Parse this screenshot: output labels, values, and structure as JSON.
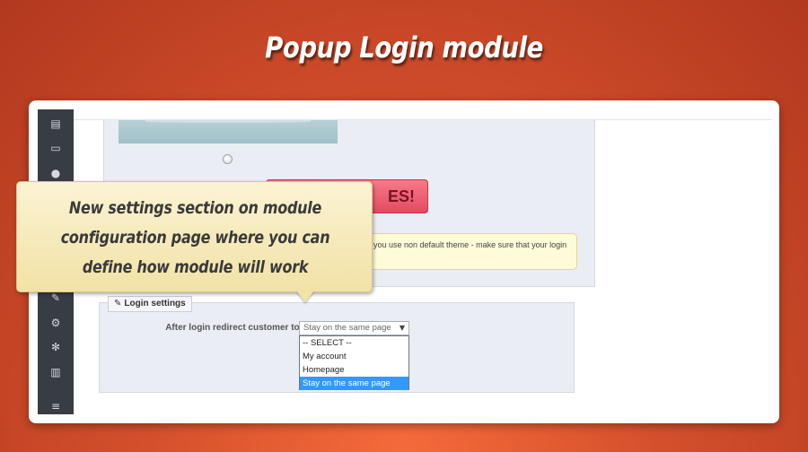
{
  "promo": {
    "title": "Popup Login module",
    "callout_lines": [
      "New settings section on module",
      "configuration page where you can",
      "define how module will work"
    ]
  },
  "sidebar": {
    "icons": [
      "book-icon",
      "credit-card-icon",
      "users-icon",
      "wrench-icon",
      "cogs-icon",
      "gear-icon",
      "bar-chart-icon",
      "menu-icon"
    ]
  },
  "preview": {
    "button_label": "ES!",
    "note_lines": [
      "you use non default theme - make sure that your login",
      ""
    ]
  },
  "login_settings": {
    "legend": "Login settings",
    "field_label": "After login redirect customer to:",
    "selected_value": "Stay on the same page",
    "options": [
      "-- SELECT --",
      "My account",
      "Homepage",
      "Stay on the same page"
    ],
    "selected_index": 3
  },
  "colors": {
    "background": "#d4502c",
    "sidebar": "#383d44",
    "selected_option": "#3399ff",
    "callout": "#f2e2a6"
  }
}
